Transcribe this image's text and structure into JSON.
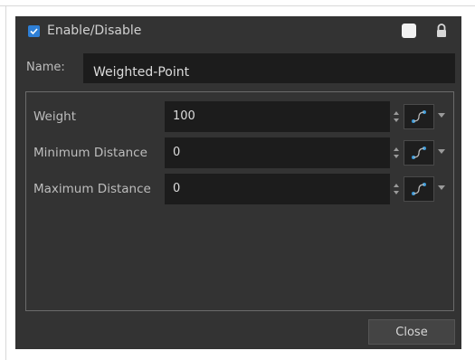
{
  "header": {
    "enable_label": "Enable/Disable",
    "enabled": true
  },
  "name": {
    "label": "Name:",
    "value": "Weighted-Point"
  },
  "params": [
    {
      "label": "Weight",
      "value": "100"
    },
    {
      "label": "Minimum Distance",
      "value": "0"
    },
    {
      "label": "Maximum Distance",
      "value": "0"
    }
  ],
  "footer": {
    "close_label": "Close"
  },
  "colors": {
    "dialog_bg": "#333333",
    "field_bg": "#1c1c1c",
    "accent": "#2e7fd6",
    "function_curve": "#3a9ad9"
  },
  "icons": [
    "checkbox-icon",
    "color-swatch-icon",
    "lock-icon",
    "spinner-arrows-icon",
    "function-curve-icon",
    "dropdown-arrow-icon"
  ]
}
